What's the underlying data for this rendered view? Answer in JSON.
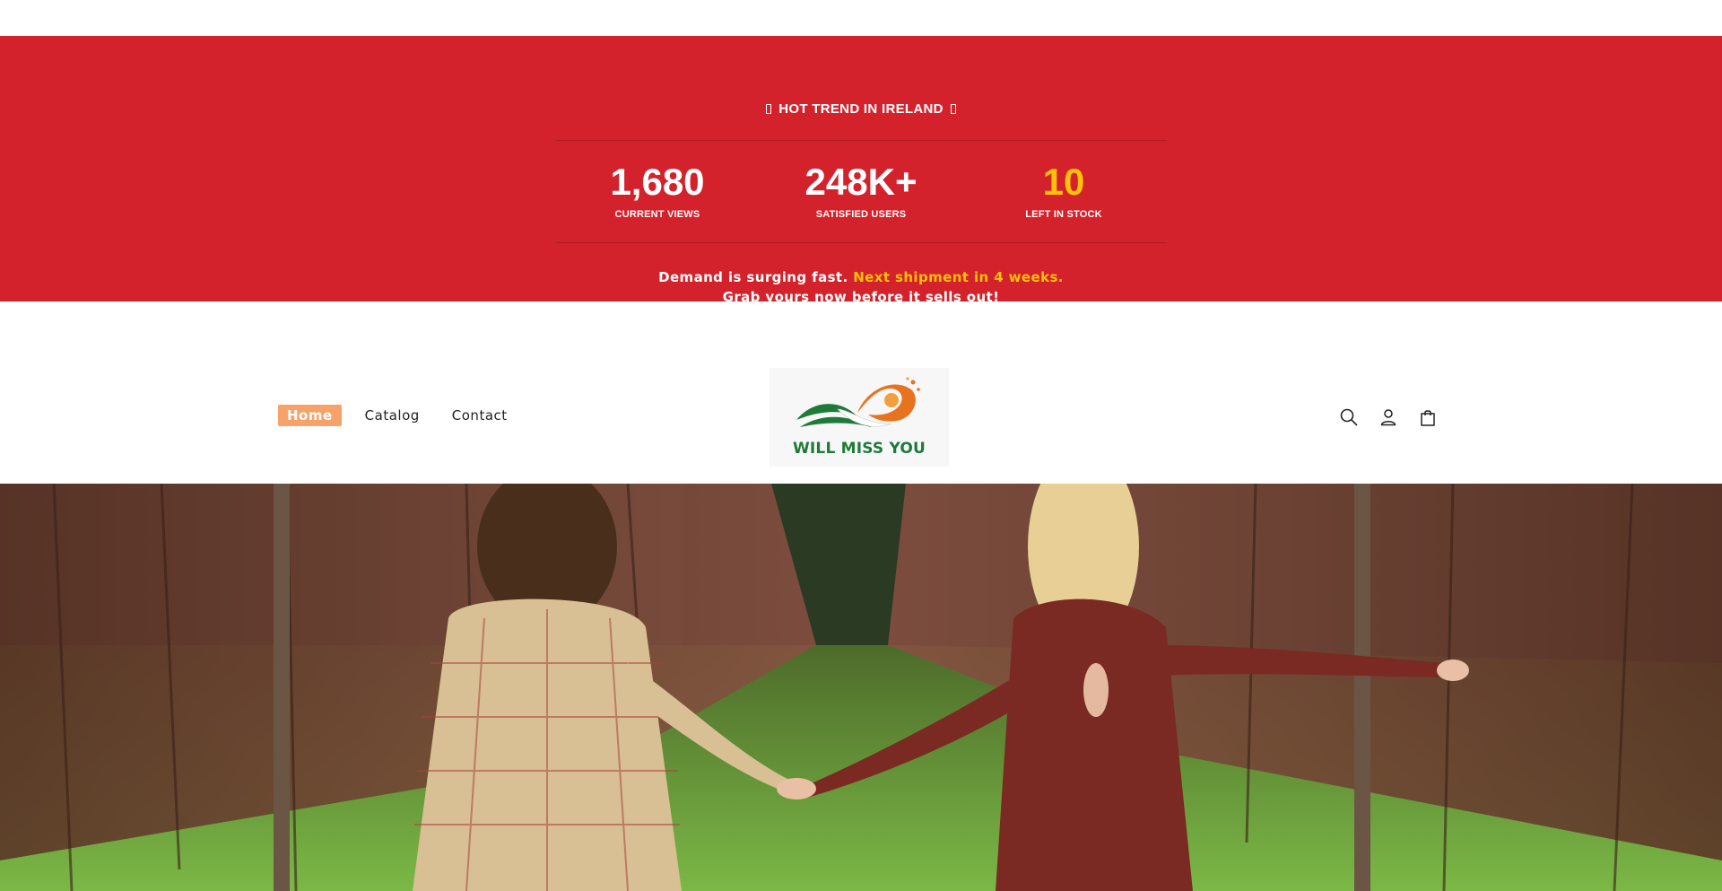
{
  "promo": {
    "heading": "HOT TREND IN IRELAND",
    "stats": [
      {
        "value": "1,680",
        "label": "CURRENT VIEWS"
      },
      {
        "value": "248K+",
        "label": "SATISFIED USERS"
      },
      {
        "value": "10",
        "label": "LEFT IN STOCK"
      }
    ],
    "message_part1": "Demand is surging fast.",
    "message_highlight": "Next shipment in 4 weeks.",
    "message_line2": "Grab yours now before it sells out!",
    "colors": {
      "banner_bg": "#d3222b",
      "highlight": "#ffc107"
    }
  },
  "header": {
    "nav": [
      {
        "label": "Home",
        "active": true
      },
      {
        "label": "Catalog",
        "active": false
      },
      {
        "label": "Contact",
        "active": false
      }
    ],
    "logo_text": "WILL MISS YOU",
    "icons": [
      "search-icon",
      "account-icon",
      "cart-icon"
    ],
    "colors": {
      "active_nav_bg": "#f7a26b",
      "logo_green": "#1f7a3a",
      "logo_orange": "#e8731f"
    }
  },
  "hero": {
    "image": "two-women-holding-hands-in-vineyard"
  }
}
